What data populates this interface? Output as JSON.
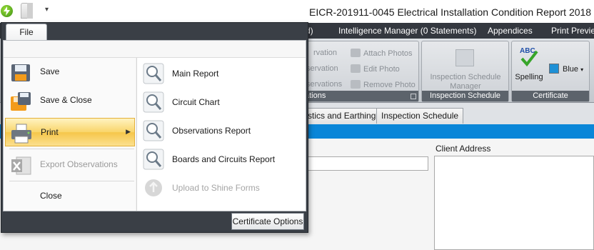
{
  "window": {
    "title": "EICR-201911-0045 Electrical Installation Condition Report 2018",
    "qat_dropdown": "▾"
  },
  "ribbon_tabs": [
    {
      "label": "d)"
    },
    {
      "label": "Intelligence Manager (0 Statements)"
    },
    {
      "label": "Appendices"
    },
    {
      "label": "Print Preview"
    }
  ],
  "ribbon": {
    "observations_group": {
      "items": [
        "rvation",
        "servation",
        "servations"
      ],
      "label": "ations"
    },
    "photo_group": {
      "items": [
        "Attach Photos",
        "Edit Photo",
        "Remove Photo"
      ]
    },
    "inspection_group": {
      "button": "Inspection Schedule Manager",
      "label": "Inspection Schedule"
    },
    "certificate_group": {
      "spelling": "Spelling",
      "spelling_icon_text": "ABC",
      "color": "Blue",
      "label": "Certificate"
    }
  },
  "doc_tabs": [
    "stics and Earthing",
    "Inspection Schedule"
  ],
  "form": {
    "client_address_label": "Client Address"
  },
  "file_menu": {
    "tab_label": "File",
    "items": [
      {
        "label": "Save",
        "icon": "save-icon",
        "enabled": true
      },
      {
        "label": "Save & Close",
        "icon": "save-close-icon",
        "enabled": true
      },
      {
        "label": "Print",
        "icon": "printer-icon",
        "enabled": true,
        "selected": true
      },
      {
        "label": "Export Observations",
        "icon": "excel-icon",
        "enabled": false
      },
      {
        "label": "Close",
        "enabled": true
      }
    ],
    "print_submenu": [
      {
        "label": "Main Report",
        "icon": "magnifier-icon",
        "enabled": true
      },
      {
        "label": "Circuit Chart",
        "icon": "magnifier-icon",
        "enabled": true
      },
      {
        "label": "Observations Report",
        "icon": "magnifier-icon",
        "enabled": true
      },
      {
        "label": "Boards and Circuits Report",
        "icon": "magnifier-icon",
        "enabled": true
      },
      {
        "label": "Upload to Shine Forms",
        "icon": "upload-icon",
        "enabled": false
      }
    ],
    "certificate_options": "Certificate Options"
  },
  "colors": {
    "accent_blue": "#0a86d8",
    "ribbon_dark": "#34383f",
    "selected_item": "#f9d56a"
  }
}
